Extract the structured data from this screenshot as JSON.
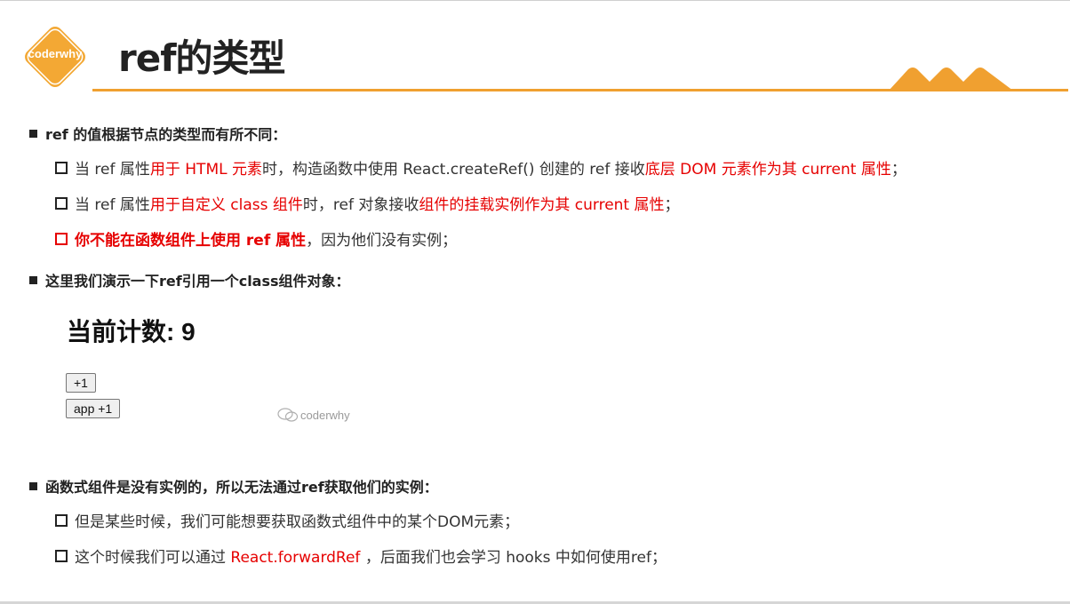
{
  "header": {
    "logo_text": "coderwhy",
    "title": "ref的类型",
    "accent_color": "#f0a030"
  },
  "section1": {
    "heading": "ref 的值根据节点的类型而有所不同：",
    "items": [
      {
        "p1": "当 ref 属性",
        "p2": "用于 HTML 元素",
        "p3": "时，构造函数中使用 React.createRef() 创建的 ref 接收",
        "p4": "底层 DOM 元素作为其 current 属性",
        "p5": "；"
      },
      {
        "p1": "当 ref 属性",
        "p2": "用于自定义 class 组件",
        "p3": "时，ref 对象接收",
        "p4": "组件的挂载实例作为其 current 属性",
        "p5": "；"
      },
      {
        "p1": "你不能在函数组件上使用 ref 属性",
        "p2": "，因为他们没有实例；"
      }
    ]
  },
  "section2": {
    "heading": "这里我们演示一下ref引用一个class组件对象："
  },
  "demo": {
    "count_label": "当前计数: 9",
    "btn_plus": "+1",
    "btn_app_plus": "app +1",
    "watermark": "coderwhy"
  },
  "section3": {
    "heading": "函数式组件是没有实例的，所以无法通过ref获取他们的实例：",
    "items": [
      {
        "p1": "但是某些时候，我们可能想要获取函数式组件中的某个DOM元素；"
      },
      {
        "p1": "这个时候我们可以通过 ",
        "p2": "React.forwardRef",
        "p3": " ，后面我们也会学习 hooks 中如何使用ref；"
      }
    ]
  },
  "colors": {
    "highlight": "#e60000"
  }
}
